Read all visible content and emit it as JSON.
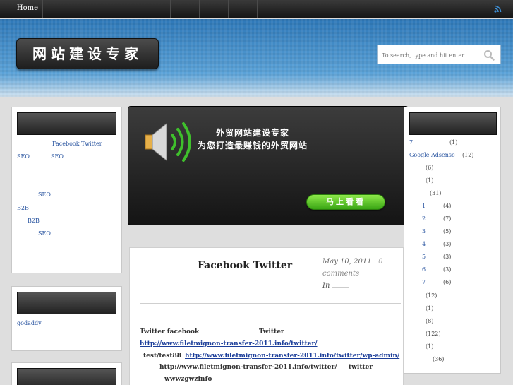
{
  "nav": {
    "items": [
      "Home",
      "",
      "",
      "",
      "",
      "",
      "",
      ""
    ]
  },
  "header": {
    "logo_text": "网站建设专家",
    "search_placeholder": "To search, type and hit enter"
  },
  "sidebar_left": {
    "widget1_links": [
      "Facebook  Twitter",
      "SEO",
      "SEO",
      "SEO",
      "B2B",
      "B2B",
      "SEO"
    ],
    "widget2_links": [
      "godaddy"
    ]
  },
  "banner": {
    "line1": "外贸网站建设专家",
    "line2": "为您打造最赚钱的外贸网站",
    "button_label": "马上看看"
  },
  "post": {
    "title": "Facebook  Twitter",
    "date": "May 10, 2011",
    "separator": "·",
    "comment_count": "0",
    "comments_label": "comments",
    "in_label": "In",
    "body": {
      "line1_a": "Twitter  facebook",
      "line1_b": "Twitter",
      "link1": "http://www.filetmignon-transfer-2011.info/twitter/",
      "line3_a": "test/test88",
      "link2": "http://www.filetmignon-transfer-2011.info/twitter/wp-admin/",
      "line4_a": "http://www.filetmignon-transfer-2011.info/twitter/",
      "line4_b": "twitter",
      "line5": "wwwzgwzinfo"
    }
  },
  "sidebar_right": {
    "items": [
      {
        "label": "7",
        "count": "(1)"
      },
      {
        "label": "Google Adsense",
        "count": "(12)"
      },
      {
        "label": "",
        "count": "(6)"
      },
      {
        "label": "",
        "count": "(1)"
      },
      {
        "label": "",
        "count": "(31)"
      },
      {
        "label": "1",
        "count": "(4)"
      },
      {
        "label": "2",
        "count": "(7)"
      },
      {
        "label": "3",
        "count": "(5)"
      },
      {
        "label": "4",
        "count": "(3)"
      },
      {
        "label": "5",
        "count": "(3)"
      },
      {
        "label": "6",
        "count": "(3)"
      },
      {
        "label": "7",
        "count": "(6)"
      },
      {
        "label": "",
        "count": "(12)"
      },
      {
        "label": "",
        "count": "(1)"
      },
      {
        "label": "",
        "count": "(8)"
      },
      {
        "label": "",
        "count": "(122)"
      },
      {
        "label": "",
        "count": "(1)"
      },
      {
        "label": "",
        "count": "(36)"
      }
    ]
  },
  "colors": {
    "accent_link": "#2a55a0",
    "button_green": "#5ccb2a",
    "header_blue": "#3f86c2"
  }
}
